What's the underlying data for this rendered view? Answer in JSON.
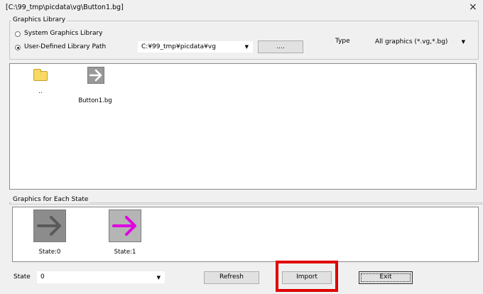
{
  "window": {
    "title": "[C:\\99_tmp\\picdata\\vg\\Button1.bg]",
    "close_glyph": "×"
  },
  "library": {
    "group_label": "Graphics Library",
    "system_label": "System Graphics Library",
    "user_label": "User-Defined Library Path",
    "selected": "User-Defined Library Path",
    "path_value": "C:¥99_tmp¥picdata¥vg",
    "browse_label": "....",
    "type_label": "Type",
    "type_value": "All graphics (*.vg,*.bg)"
  },
  "files": [
    {
      "kind": "folder",
      "label": ".."
    },
    {
      "kind": "graphic",
      "label": "Button1.bg"
    }
  ],
  "states": {
    "group_label": "Graphics for Each State",
    "items": [
      {
        "label": "State:0",
        "arrow_color": "#8a8a8a"
      },
      {
        "label": "State:1",
        "arrow_color": "#e000e0"
      }
    ]
  },
  "footer": {
    "state_label": "State",
    "state_value": "0",
    "refresh_label": "Refresh",
    "import_label": "Import",
    "exit_label": "Exit"
  },
  "colors": {
    "highlight": "#e00000",
    "state1_arrow": "#e000e0"
  }
}
